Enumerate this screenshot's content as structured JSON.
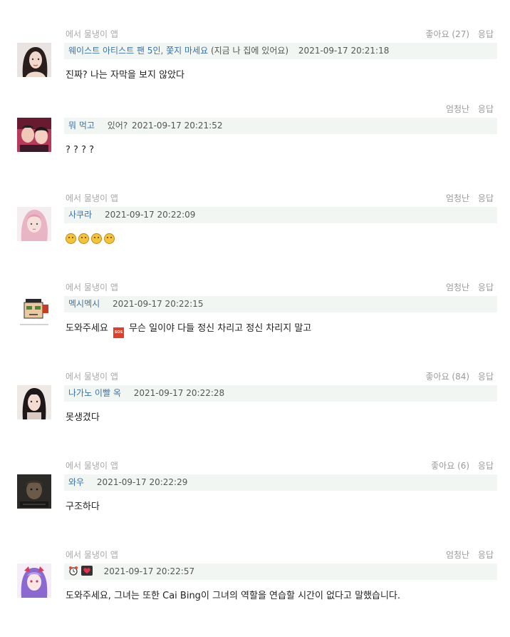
{
  "comments": [
    {
      "source": "에서 물냉이 앱",
      "like": "좋아요 (27)",
      "reply": "응답",
      "name": "웨이스트 아티스트 팬 5인, 쫓지 마세요",
      "name_extra": "(지금 나 집에 있어요)",
      "time": "2021-09-17 20:21:18",
      "text": "진짜? 나는 자막을 보지 않았다",
      "avatar": "woman-portrait"
    },
    {
      "source": "",
      "like": "엄청난",
      "reply": "응답",
      "name": "뭐 먹고",
      "name_extra": "있어?",
      "time": "2021-09-17 20:21:52",
      "text": "? ? ? ?",
      "avatar": "couple-photo"
    },
    {
      "source": "에서 물냉이 앱",
      "like": "엄청난",
      "reply": "응답",
      "name": "사쿠라",
      "name_extra": "",
      "time": "2021-09-17 20:22:09",
      "text": "",
      "emoji_count": 4,
      "avatar": "pink-hair-girl"
    },
    {
      "source": "에서 물냉이 앱",
      "like": "엄청난",
      "reply": "응답",
      "name": "멕시멕시",
      "name_extra": "",
      "time": "2021-09-17 20:22:15",
      "text_before": "도와주세요",
      "sos_label": "SOS",
      "text_after": "무슨 일이야 다들 정신 차리고 정신 차리지 말고",
      "avatar": "cartoon-meme"
    },
    {
      "source": "에서 물냉이 앱",
      "like": "좋아요 (84)",
      "reply": "응답",
      "name": "나가노 이빨 옥",
      "name_extra": "",
      "time": "2021-09-17 20:22:28",
      "text": "못생겼다",
      "avatar": "girl-portrait"
    },
    {
      "source": "에서 물냉이 앱",
      "like": "좋아요 (6)",
      "reply": "응답",
      "name": "와우",
      "name_extra": "",
      "time": "2021-09-17 20:22:29",
      "text": "구조하다",
      "avatar": "dark-portrait"
    },
    {
      "source": "에서 물냉이 앱",
      "like": "엄청난",
      "reply": "응답",
      "name": "",
      "name_icons": [
        "alarm-clock-icon",
        "heart-icon"
      ],
      "name_extra": "",
      "time": "2021-09-17 20:22:57",
      "text": "도와주세요, 그녀는 또한 Cai Bing이 그녀의 역할을 연습할 시간이 없다고 말했습니다.",
      "avatar": "anime-girl"
    }
  ],
  "colors": {
    "name_link": "#3a73a8",
    "namebar_bg": "#f1f6f2",
    "muted_text": "#9a9a9a"
  }
}
